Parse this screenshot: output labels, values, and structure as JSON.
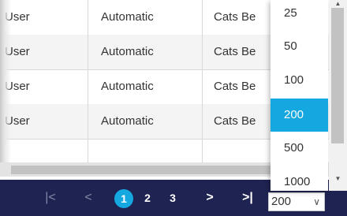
{
  "grid": {
    "rows": [
      {
        "c1": "User",
        "c2": "Automatic",
        "c3": "Cats Be"
      },
      {
        "c1": "User",
        "c2": "Automatic",
        "c3": "Cats Be"
      },
      {
        "c1": "User",
        "c2": "Automatic",
        "c3": "Cats Be"
      },
      {
        "c1": "User",
        "c2": "Automatic",
        "c3": "Cats Be"
      }
    ]
  },
  "pager": {
    "first": "|<",
    "prev": "<",
    "pages": [
      "1",
      "2",
      "3"
    ],
    "active_page": "1",
    "next": ">",
    "last": ">|",
    "page_size": "200",
    "page_size_chevron": "∨"
  },
  "page_size_options": [
    "25",
    "50",
    "100",
    "200",
    "500",
    "1000"
  ],
  "selected_option": "200",
  "colors": {
    "pager_bg": "#1f2352",
    "accent": "#14a7e0"
  },
  "icons": {
    "scroll_up": "scroll-up-arrow-icon",
    "scroll_down": "scroll-down-arrow-icon"
  }
}
